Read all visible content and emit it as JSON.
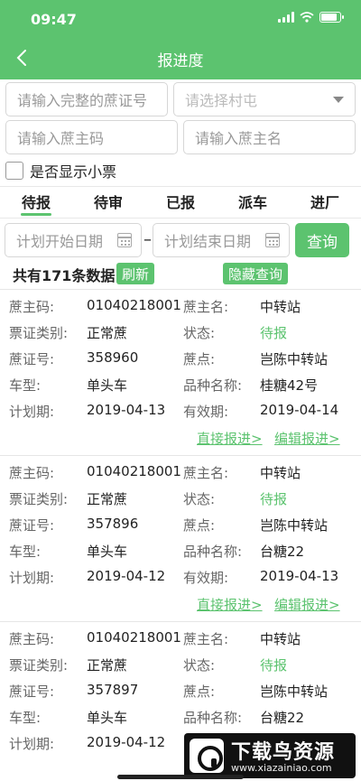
{
  "status_bar": {
    "time": "09:47"
  },
  "nav": {
    "title": "报进度"
  },
  "filters": {
    "cert_placeholder": "请输入完整的蔗证号",
    "village_placeholder": "请选择村屯",
    "grower_code_placeholder": "请输入蔗主码",
    "grower_name_placeholder": "请输入蔗主名",
    "show_ticket_label": "是否显示小票",
    "start_date_placeholder": "计划开始日期",
    "end_date_placeholder": "计划结束日期",
    "date_separator": "–",
    "query_label": "查询"
  },
  "tabs": [
    {
      "label": "待报"
    },
    {
      "label": "待审"
    },
    {
      "label": "已报"
    },
    {
      "label": "派车"
    },
    {
      "label": "进厂"
    }
  ],
  "summary": {
    "count_text": "共有171条数据",
    "refresh_label": "刷新",
    "hide_query_label": "隐藏查询"
  },
  "field_labels": {
    "grower_code": "蔗主码:",
    "grower_name": "蔗主名:",
    "ticket_type": "票证类别:",
    "status": "状态:",
    "cert_no": "蔗证号:",
    "point": "蔗点:",
    "vehicle": "车型:",
    "variety": "品种名称:",
    "plan_date": "计划期:",
    "valid_date": "有效期:"
  },
  "actions": {
    "direct_report": "直接报进>",
    "edit_report": "编辑报进>"
  },
  "records": [
    {
      "grower_code": "01040218001",
      "grower_name": "中转站",
      "ticket_type": "正常蔗",
      "status": "待报",
      "cert_no": "358960",
      "point": "岂陈中转站",
      "vehicle": "单头车",
      "variety": "桂糖42号",
      "plan_date": "2019-04-13",
      "valid_date": "2019-04-14"
    },
    {
      "grower_code": "01040218001",
      "grower_name": "中转站",
      "ticket_type": "正常蔗",
      "status": "待报",
      "cert_no": "357896",
      "point": "岂陈中转站",
      "vehicle": "单头车",
      "variety": "台糖22",
      "plan_date": "2019-04-12",
      "valid_date": "2019-04-13"
    },
    {
      "grower_code": "01040218001",
      "grower_name": "中转站",
      "ticket_type": "正常蔗",
      "status": "待报",
      "cert_no": "357897",
      "point": "岂陈中转站",
      "vehicle": "单头车",
      "variety": "台糖22",
      "plan_date": "2019-04-12"
    }
  ],
  "watermark": {
    "title": "下载鸟资源",
    "url": "www.xiazainiao.com"
  },
  "colors": {
    "accent": "#5cc36f"
  }
}
